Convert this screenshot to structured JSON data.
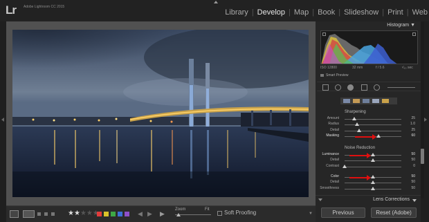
{
  "app": {
    "logo": "Lr",
    "title": "Adobe Lightroom CC 2015"
  },
  "modules": [
    {
      "label": "Library",
      "active": false
    },
    {
      "label": "Develop",
      "active": true
    },
    {
      "label": "Map",
      "active": false
    },
    {
      "label": "Book",
      "active": false
    },
    {
      "label": "Slideshow",
      "active": false
    },
    {
      "label": "Print",
      "active": false
    },
    {
      "label": "Web",
      "active": false
    }
  ],
  "histogram": {
    "title": "Histogram",
    "iso": "ISO 12800",
    "focal": "32 mm",
    "aperture": "f / 5.6",
    "shutter": "¹⁄₆₀ sec",
    "smart_preview": "Smart Preview"
  },
  "sharpening": {
    "title": "Sharpening",
    "sliders": [
      {
        "label": "Amount",
        "value": "25",
        "level": 0.17
      },
      {
        "label": "Radius",
        "value": "1.0",
        "level": 0.22
      },
      {
        "label": "Detail",
        "value": "25",
        "level": 0.25
      },
      {
        "label": "Masking",
        "value": "60",
        "level": 0.6,
        "highlight": true
      }
    ]
  },
  "noise_reduction": {
    "title": "Noise Reduction",
    "sliders": [
      {
        "label": "Luminance",
        "value": "50",
        "level": 0.5,
        "highlight": true
      },
      {
        "label": "Detail",
        "value": "50",
        "level": 0.5
      },
      {
        "label": "Contrast",
        "value": "0",
        "level": 0.0
      },
      {
        "label": "Color",
        "value": "50",
        "level": 0.5,
        "highlight": true
      },
      {
        "label": "Detail",
        "value": "50",
        "level": 0.5
      },
      {
        "label": "Smoothness",
        "value": "50",
        "level": 0.5
      }
    ]
  },
  "lens_corrections": {
    "title": "Lens Corrections"
  },
  "toolbar": {
    "rating": 2,
    "rating_max": 5,
    "color_labels": [
      "#e23b3b",
      "#d9c22a",
      "#3ea845",
      "#3a6fd6",
      "#8e4fc9"
    ],
    "zoom_label": "Zoom",
    "fit_label": "Fit",
    "soft_proofing": "Soft Proofing"
  },
  "buttons": {
    "previous": "Previous",
    "reset": "Reset (Adobe)"
  }
}
